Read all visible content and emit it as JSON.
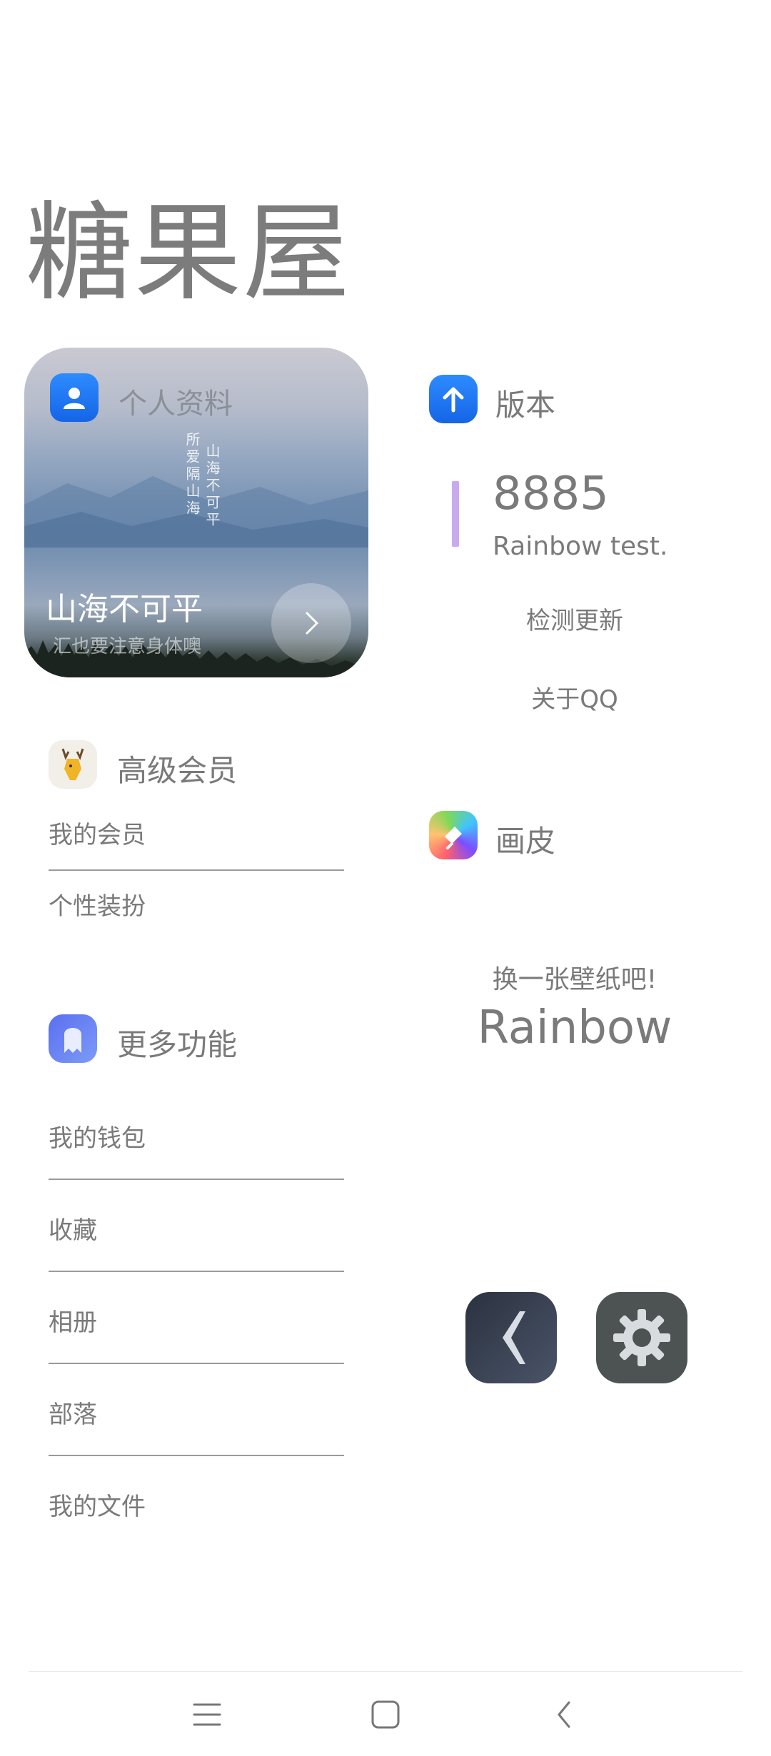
{
  "app": {
    "title": "糖果屋"
  },
  "profile_card": {
    "label": "个人资料",
    "poem_left": "所爱隔山海",
    "poem_right": "山海不可平",
    "headline": "山海不可平",
    "subtitle": "汇也要注意身体噢"
  },
  "premium": {
    "label": "高级会员",
    "items": [
      "我的会员",
      "个性装扮"
    ]
  },
  "more": {
    "label": "更多功能",
    "items": [
      "我的钱包",
      "收藏",
      "相册",
      "部落",
      "我的文件"
    ]
  },
  "version": {
    "label": "版本",
    "number": "8885",
    "desc": "Rainbow test.",
    "check_update": "检测更新",
    "about": "关于QQ"
  },
  "skin": {
    "label": "画皮",
    "prompt": "换一张壁纸吧!",
    "name": "Rainbow"
  },
  "icons": {
    "profile": "person-icon",
    "version": "arrow-up-icon",
    "premium": "deer-icon",
    "more": "ghost-icon",
    "skin": "brush-icon",
    "back": "back-chevron-icon",
    "settings": "gear-icon"
  },
  "colors": {
    "accent_blue": "#1f7bf5",
    "version_bar": "#c9a9ef",
    "text": "#7a7a7a"
  }
}
